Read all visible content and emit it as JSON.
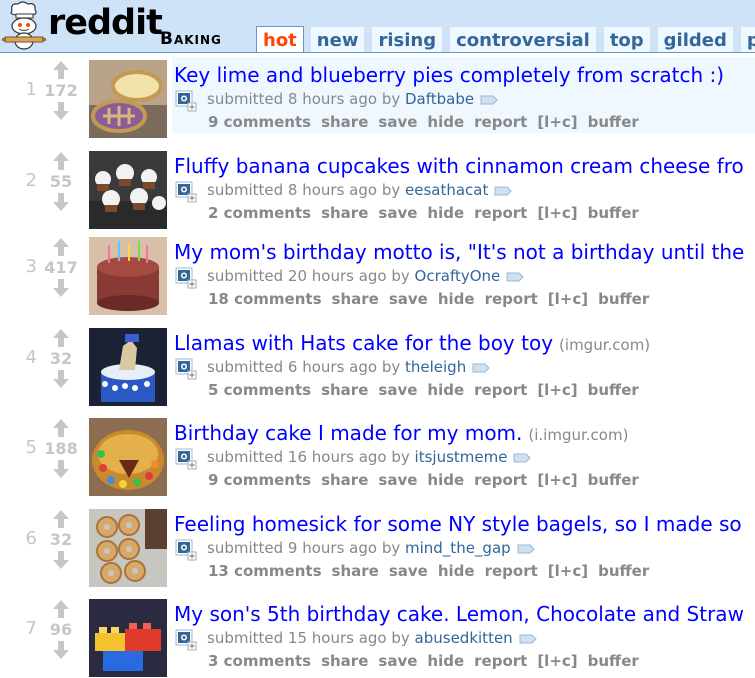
{
  "header": {
    "wordmark": "reddit",
    "subreddit": "Baking",
    "tabs": [
      "hot",
      "new",
      "rising",
      "controversial",
      "top",
      "gilded",
      "p"
    ],
    "selected_tab": "hot",
    "colors": {
      "bar": "#cee3f8",
      "selected_tab_text": "#ff4500",
      "tab_text": "#336699"
    }
  },
  "posts": [
    {
      "rank": "1",
      "score": "172",
      "title": "Key lime and blueberry pies completely from scratch :)",
      "domain": "",
      "submitted": "submitted 8 hours ago by",
      "author": "Daftbabe",
      "comments": "9 comments",
      "thumb": "pies"
    },
    {
      "rank": "2",
      "score": "55",
      "title": "Fluffy banana cupcakes with cinnamon cream cheese fro",
      "domain": "",
      "submitted": "submitted 8 hours ago by",
      "author": "eesathacat",
      "comments": "2 comments",
      "thumb": "cupcakes"
    },
    {
      "rank": "3",
      "score": "417",
      "title": "My mom's birthday motto is, \"It's not a birthday until the",
      "domain": "",
      "submitted": "submitted 20 hours ago by",
      "author": "OcraftyOne",
      "comments": "18 comments",
      "thumb": "chocolate-cake"
    },
    {
      "rank": "4",
      "score": "32",
      "title": "Llamas with Hats cake for the boy toy",
      "domain": "(imgur.com)",
      "submitted": "submitted 6 hours ago by",
      "author": "theleigh",
      "comments": "5 comments",
      "thumb": "llama-cake"
    },
    {
      "rank": "5",
      "score": "188",
      "title": "Birthday cake I made for my mom.",
      "domain": "(i.imgur.com)",
      "submitted": "submitted 16 hours ago by",
      "author": "itsjustmeme",
      "comments": "9 comments",
      "thumb": "candy-cake"
    },
    {
      "rank": "6",
      "score": "32",
      "title": "Feeling homesick for some NY style bagels, so I made so",
      "domain": "",
      "submitted": "submitted 9 hours ago by",
      "author": "mind_the_gap",
      "comments": "13 comments",
      "thumb": "bagels"
    },
    {
      "rank": "7",
      "score": "96",
      "title": "My son's 5th birthday cake. Lemon, Chocolate and Straw",
      "domain": "",
      "submitted": "submitted 15 hours ago by",
      "author": "abusedkitten",
      "comments": "3 comments",
      "thumb": "lego-cake"
    }
  ],
  "actions": {
    "share": "share",
    "save": "save",
    "hide": "hide",
    "report": "report",
    "lc": "[l+c]",
    "buffer": "buffer"
  },
  "colors": {
    "title_link": "#0000ff",
    "tagline": "#888888",
    "author": "#336699",
    "rank": "#c6c6c6",
    "first_row_bg": "#eff7ff"
  }
}
